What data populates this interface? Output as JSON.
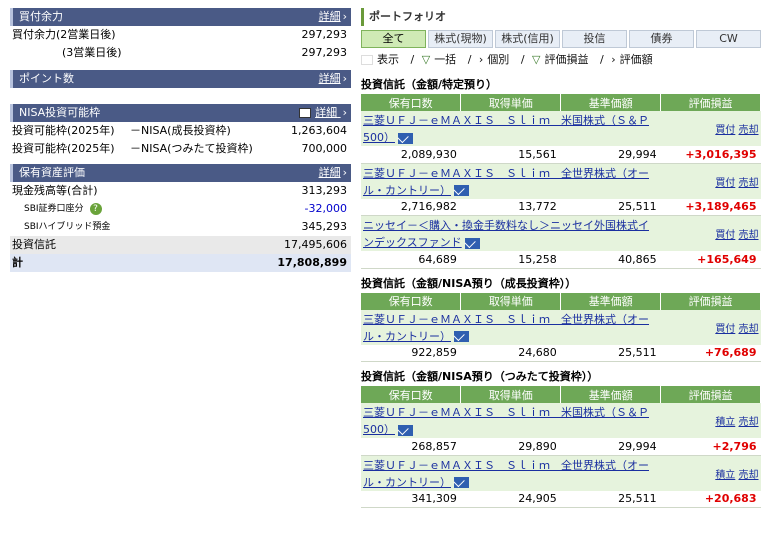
{
  "left": {
    "kaitsuke": {
      "title": "買付余力",
      "more": "詳細",
      "rows": [
        {
          "label": "買付余力(2営業日後)",
          "value": "297,293"
        },
        {
          "label": "(3営業日後)",
          "value": "297,293"
        }
      ]
    },
    "points": {
      "title": "ポイント数",
      "more": "詳細"
    },
    "nisa": {
      "title": "NISA投資可能枠",
      "more": "詳細",
      "rows": [
        {
          "label": "投資可能枠(2025年)",
          "sub": "－NISA(成長投資枠)",
          "value": "1,263,604"
        },
        {
          "label": "投資可能枠(2025年)",
          "sub": "－NISA(つみたて投資枠)",
          "value": "700,000"
        }
      ]
    },
    "assets": {
      "title": "保有資産評価",
      "more": "詳細",
      "cash_label": "現金残高等(合計)",
      "cash_value": "313,293",
      "sbi_label": "SBI証券口座分",
      "sbi_value": "-32,000",
      "hybrid_label": "SBIハイブリッド預金",
      "hybrid_value": "345,293",
      "toushin_label": "投資信託",
      "toushin_value": "17,495,606",
      "total_label": "計",
      "total_value": "17,808,899"
    }
  },
  "right": {
    "title": "ポートフォリオ",
    "tabs": [
      "全て",
      "株式(現物)",
      "株式(信用)",
      "投信",
      "債券",
      "CW"
    ],
    "toolbar": {
      "display": "表示",
      "bulk": "一括",
      "individual": "個別",
      "eval": "評価損益",
      "price": "評価額",
      "sep": "/"
    },
    "headers": [
      "保有口数",
      "取得単価",
      "基準価額",
      "評価損益"
    ],
    "groups": [
      {
        "title": "投資信託（金額/特定預り）",
        "funds": [
          {
            "name": "三菱ＵＦＪ－ｅＭＡＸＩＳ　Ｓｌｉｍ　米国株式（Ｓ＆Ｐ500）",
            "a1": "買付",
            "a2": "売却",
            "units": "2,089,930",
            "cost": "15,561",
            "nav": "29,994",
            "pl": "+3,016,395"
          },
          {
            "name": "三菱ＵＦＪ－ｅＭＡＸＩＳ　Ｓｌｉｍ　全世界株式（オール・カントリー）",
            "a1": "買付",
            "a2": "売却",
            "units": "2,716,982",
            "cost": "13,772",
            "nav": "25,511",
            "pl": "+3,189,465"
          },
          {
            "name": "ニッセイ－＜購入・換金手数料なし＞ニッセイ外国株式インデックスファンド",
            "a1": "買付",
            "a2": "売却",
            "units": "64,689",
            "cost": "15,258",
            "nav": "40,865",
            "pl": "+165,649"
          }
        ]
      },
      {
        "title": "投資信託（金額/NISA預り（成長投資枠））",
        "funds": [
          {
            "name": "三菱ＵＦＪ－ｅＭＡＸＩＳ　Ｓｌｉｍ　全世界株式（オール・カントリー）",
            "a1": "買付",
            "a2": "売却",
            "units": "922,859",
            "cost": "24,680",
            "nav": "25,511",
            "pl": "+76,689"
          }
        ]
      },
      {
        "title": "投資信託（金額/NISA預り（つみたて投資枠））",
        "funds": [
          {
            "name": "三菱ＵＦＪ－ｅＭＡＸＩＳ　Ｓｌｉｍ　米国株式（Ｓ＆Ｐ500）",
            "a1": "積立",
            "a2": "売却",
            "units": "268,857",
            "cost": "29,890",
            "nav": "29,994",
            "pl": "+2,796"
          },
          {
            "name": "三菱ＵＦＪ－ｅＭＡＸＩＳ　Ｓｌｉｍ　全世界株式（オール・カントリー）",
            "a1": "積立",
            "a2": "売却",
            "units": "341,309",
            "cost": "24,905",
            "nav": "25,511",
            "pl": "+20,683"
          }
        ]
      }
    ]
  }
}
